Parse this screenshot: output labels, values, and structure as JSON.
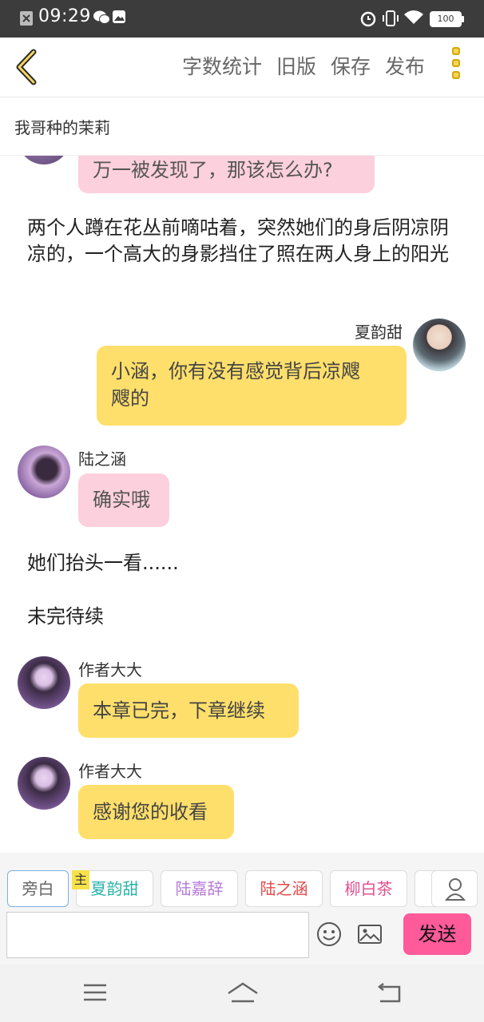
{
  "status_bar": {
    "time": "09:29",
    "battery": "100"
  },
  "nav": {
    "actions": [
      "字数统计",
      "旧版",
      "保存",
      "发布"
    ]
  },
  "book_title": "我哥种的茉莉",
  "messages": {
    "m1": "万一被发现了，那该怎么办?",
    "narration1": "两个人蹲在花丛前嘀咕着，突然她们的身后阴凉阴凉的，一个高大的身影挡住了照在两人身上的阳光",
    "m2_name": "夏韵甜",
    "m2_line1": "小涵，你有没有感觉背后凉飕",
    "m2_line2": "飕的",
    "m3_name": "陆之涵",
    "m3": "确实哦",
    "narration2": "她们抬头一看......",
    "narration3": "未完待续",
    "m4_name": "作者大大",
    "m4": "本章已完，下章继续",
    "m5_name": "作者大大",
    "m5": "感谢您的收看"
  },
  "characters": {
    "tabs": [
      {
        "label": "旁白",
        "color": "#666666"
      },
      {
        "label": "夏韵甜",
        "color": "#2bb3a8"
      },
      {
        "label": "陆嘉辞",
        "color": "#b77ad9"
      },
      {
        "label": "陆之涵",
        "color": "#e24a4a"
      },
      {
        "label": "柳白茶",
        "color": "#e2508f"
      }
    ],
    "host_badge": "主"
  },
  "composer": {
    "send_label": "发送",
    "placeholder": ""
  },
  "colors": {
    "pink_bubble": "#fcd0dc",
    "yellow_bubble": "#ffdf6b",
    "send": "#ff5a9a",
    "accent": "#f6d55c"
  }
}
